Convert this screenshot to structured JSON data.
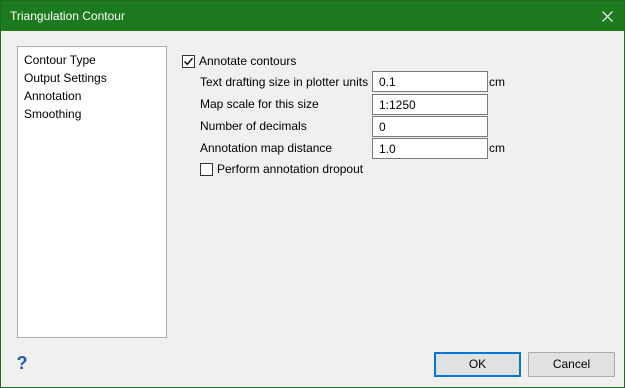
{
  "window": {
    "title": "Triangulation Contour",
    "title_bar_color": "#1e7a1e",
    "close_icon": "close-icon"
  },
  "nav": {
    "items": [
      {
        "label": "Contour Type"
      },
      {
        "label": "Output Settings"
      },
      {
        "label": "Annotation"
      },
      {
        "label": "Smoothing"
      }
    ]
  },
  "annotation": {
    "annotate_contours": {
      "label": "Annotate contours",
      "checked": true
    },
    "fields": [
      {
        "label": "Text drafting size in plotter units",
        "value": "0.1",
        "unit": "cm"
      },
      {
        "label": "Map scale for this size",
        "value": "1:1250",
        "unit": ""
      },
      {
        "label": "Number of decimals",
        "value": "0",
        "unit": ""
      },
      {
        "label": "Annotation map distance",
        "value": "1.0",
        "unit": "cm"
      }
    ],
    "perform_dropout": {
      "label": "Perform annotation dropout",
      "checked": false
    }
  },
  "footer": {
    "help_icon": "help-icon",
    "help_glyph": "?",
    "ok_label": "OK",
    "cancel_label": "Cancel"
  }
}
